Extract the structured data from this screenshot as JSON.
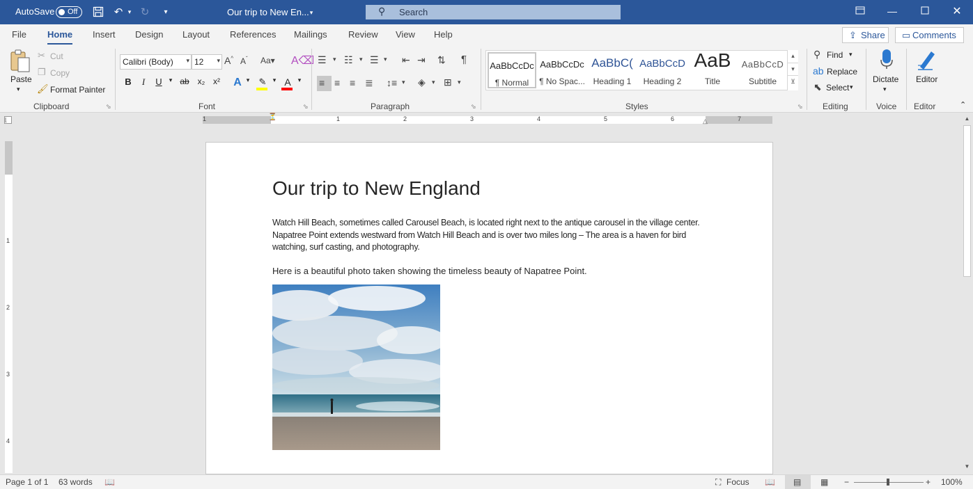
{
  "titlebar": {
    "autosave_label": "AutoSave",
    "autosave_state": "Off",
    "doc_title": "Our trip to New En...",
    "search_placeholder": "Search"
  },
  "tabs": [
    "File",
    "Home",
    "Insert",
    "Design",
    "Layout",
    "References",
    "Mailings",
    "Review",
    "View",
    "Help"
  ],
  "active_tab": "Home",
  "share_label": "Share",
  "comments_label": "Comments",
  "clipboard": {
    "paste": "Paste",
    "cut": "Cut",
    "copy": "Copy",
    "format_painter": "Format Painter",
    "group": "Clipboard"
  },
  "font": {
    "name": "Calibri (Body)",
    "size": "12",
    "group": "Font"
  },
  "paragraph": {
    "group": "Paragraph"
  },
  "styles": {
    "items": [
      {
        "preview": "AaBbCcDc",
        "name": "¶ Normal"
      },
      {
        "preview": "AaBbCcDc",
        "name": "¶ No Spac..."
      },
      {
        "preview": "AaBbC(",
        "name": "Heading 1"
      },
      {
        "preview": "AaBbCcD",
        "name": "Heading 2"
      },
      {
        "preview": "AaB",
        "name": "Title"
      },
      {
        "preview": "AaBbCcD",
        "name": "Subtitle"
      }
    ],
    "group": "Styles"
  },
  "editing": {
    "find": "Find",
    "replace": "Replace",
    "select": "Select",
    "group": "Editing"
  },
  "voice": {
    "dictate": "Dictate",
    "group": "Voice"
  },
  "editor_group": {
    "editor": "Editor",
    "group": "Editor"
  },
  "ruler": {
    "h_numbers": [
      "1",
      "1",
      "2",
      "3",
      "4",
      "5",
      "6",
      "7"
    ],
    "v_numbers": [
      "1",
      "2",
      "3",
      "4"
    ]
  },
  "document": {
    "heading": "Our trip to New England",
    "paragraph1": "Watch Hill Beach, sometimes called Carousel Beach, is located right next to the antique carousel in the village center. Napatree Point extends westward from Watch Hill Beach and is over two miles long – The area is a haven for bird watching, surf casting, and photography.",
    "paragraph2": "Here is a beautiful photo taken showing the timeless beauty of Napatree Point."
  },
  "status": {
    "page": "Page 1 of 1",
    "words": "63 words",
    "focus": "Focus",
    "zoom": "100%"
  },
  "colors": {
    "accent": "#2b579a",
    "highlight": "#ffff00",
    "font_color": "#ff0000"
  }
}
